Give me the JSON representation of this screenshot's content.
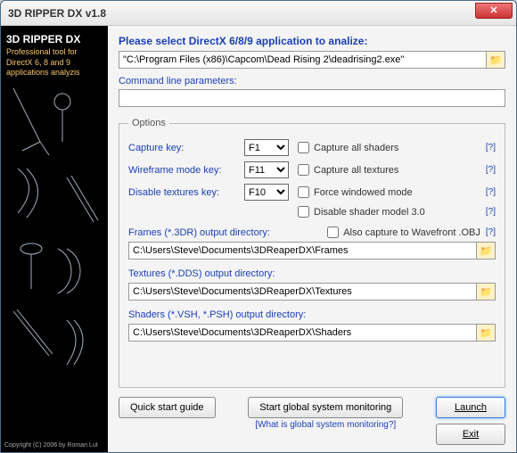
{
  "window": {
    "title": "3D RIPPER DX v1.8"
  },
  "sidebar": {
    "title": "3D RIPPER DX",
    "subtitle": "Professional tool for DirectX 6, 8 and 9 applications analyzis",
    "copyright": "Copyright (C) 2006 by Roman Lut"
  },
  "main": {
    "select_heading": "Please select DirectX 6/8/9 application to analize:",
    "exe_path": "\"C:\\Program Files (x86)\\Capcom\\Dead Rising 2\\deadrising2.exe\"",
    "cmd_label": "Command line parameters:",
    "cmd_value": ""
  },
  "options": {
    "legend": "Options",
    "capture_key_label": "Capture key:",
    "capture_key": "F1",
    "wireframe_key_label": "Wireframe mode key:",
    "wireframe_key": "F11",
    "disable_tex_key_label": "Disable textures key:",
    "disable_tex_key": "F10",
    "chk_shaders": "Capture all shaders",
    "chk_textures": "Capture all textures",
    "chk_windowed": "Force windowed mode",
    "chk_disable_sm3": "Disable shader model 3.0",
    "frames_label": "Frames (*.3DR) output directory:",
    "frames_path": "C:\\Users\\Steve\\Documents\\3DReaperDX\\Frames",
    "chk_obj": "Also capture to Wavefront .OBJ",
    "textures_label": "Textures (*.DDS) output directory:",
    "textures_path": "C:\\Users\\Steve\\Documents\\3DReaperDX\\Textures",
    "shaders_label": "Shaders (*.VSH, *.PSH) output directory:",
    "shaders_path": "C:\\Users\\Steve\\Documents\\3DReaperDX\\Shaders",
    "help": "[?]"
  },
  "bottom": {
    "quick_guide": "Quick start guide",
    "start_monitor": "Start global system monitoring",
    "what_is": "[What is global system monitoring?]",
    "launch": "Launch",
    "exit": "Exit"
  }
}
